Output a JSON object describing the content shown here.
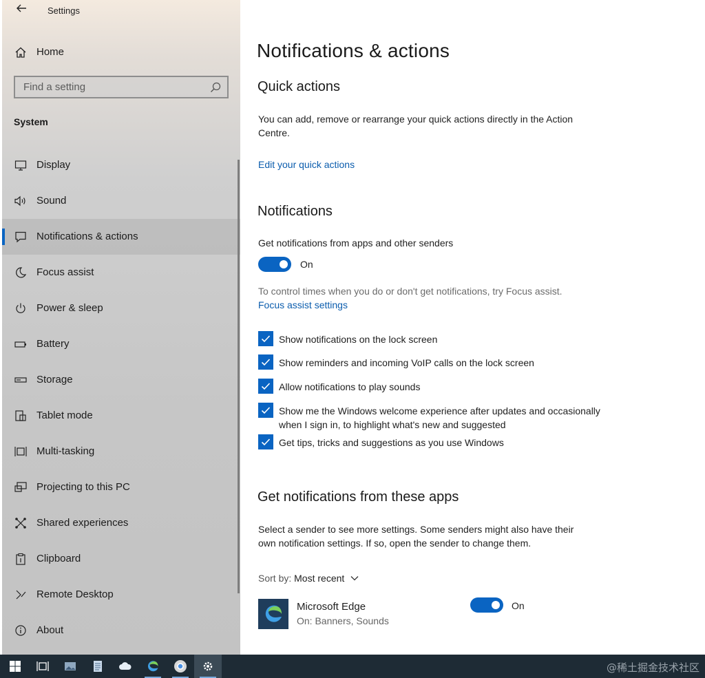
{
  "window": {
    "title": "Settings"
  },
  "sidebar": {
    "home": "Home",
    "search": {
      "placeholder": "Find a setting"
    },
    "section": "System",
    "items": [
      {
        "label": "Display",
        "icon": "monitor-icon"
      },
      {
        "label": "Sound",
        "icon": "speaker-icon"
      },
      {
        "label": "Notifications & actions",
        "icon": "message-icon",
        "selected": true
      },
      {
        "label": "Focus assist",
        "icon": "moon-icon"
      },
      {
        "label": "Power & sleep",
        "icon": "power-icon"
      },
      {
        "label": "Battery",
        "icon": "battery-icon"
      },
      {
        "label": "Storage",
        "icon": "storage-icon"
      },
      {
        "label": "Tablet mode",
        "icon": "tablet-icon"
      },
      {
        "label": "Multi-tasking",
        "icon": "multitasking-icon"
      },
      {
        "label": "Projecting to this PC",
        "icon": "projecting-icon"
      },
      {
        "label": "Shared experiences",
        "icon": "shared-icon"
      },
      {
        "label": "Clipboard",
        "icon": "clipboard-icon"
      },
      {
        "label": "Remote Desktop",
        "icon": "remote-desktop-icon"
      },
      {
        "label": "About",
        "icon": "info-icon"
      }
    ]
  },
  "main": {
    "title": "Notifications & actions",
    "quick_actions": {
      "heading": "Quick actions",
      "description": "You can add, remove or rearrange your quick actions directly in the Action Centre.",
      "link": "Edit your quick actions"
    },
    "notifications": {
      "heading": "Notifications",
      "toggle_label": "Get notifications from apps and other senders",
      "toggle_state": "On",
      "focus_hint": "To control times when you do or don't get notifications, try Focus assist.",
      "focus_link": "Focus assist settings",
      "checkboxes": [
        {
          "label": "Show notifications on the lock screen",
          "checked": true
        },
        {
          "label": "Show reminders and incoming VoIP calls on the lock screen",
          "checked": true
        },
        {
          "label": "Allow notifications to play sounds",
          "checked": true
        },
        {
          "label": "Show me the Windows welcome experience after updates and occasionally when I sign in, to highlight what's new and suggested",
          "checked": true
        },
        {
          "label": "Get tips, tricks and suggestions as you use Windows",
          "checked": true
        }
      ]
    },
    "apps": {
      "heading": "Get notifications from these apps",
      "description": "Select a sender to see more settings. Some senders might also have their own notification settings. If so, open the sender to change them.",
      "sort_label": "Sort by:",
      "sort_value": "Most recent",
      "list": [
        {
          "name": "Microsoft Edge",
          "detail": "On: Banners, Sounds",
          "state": "On"
        }
      ]
    }
  },
  "taskbar": {
    "watermark": "@稀土掘金技术社区"
  },
  "colors": {
    "accent": "#0a64c2",
    "link": "#0a5cad",
    "taskbar": "#1e2b35"
  }
}
